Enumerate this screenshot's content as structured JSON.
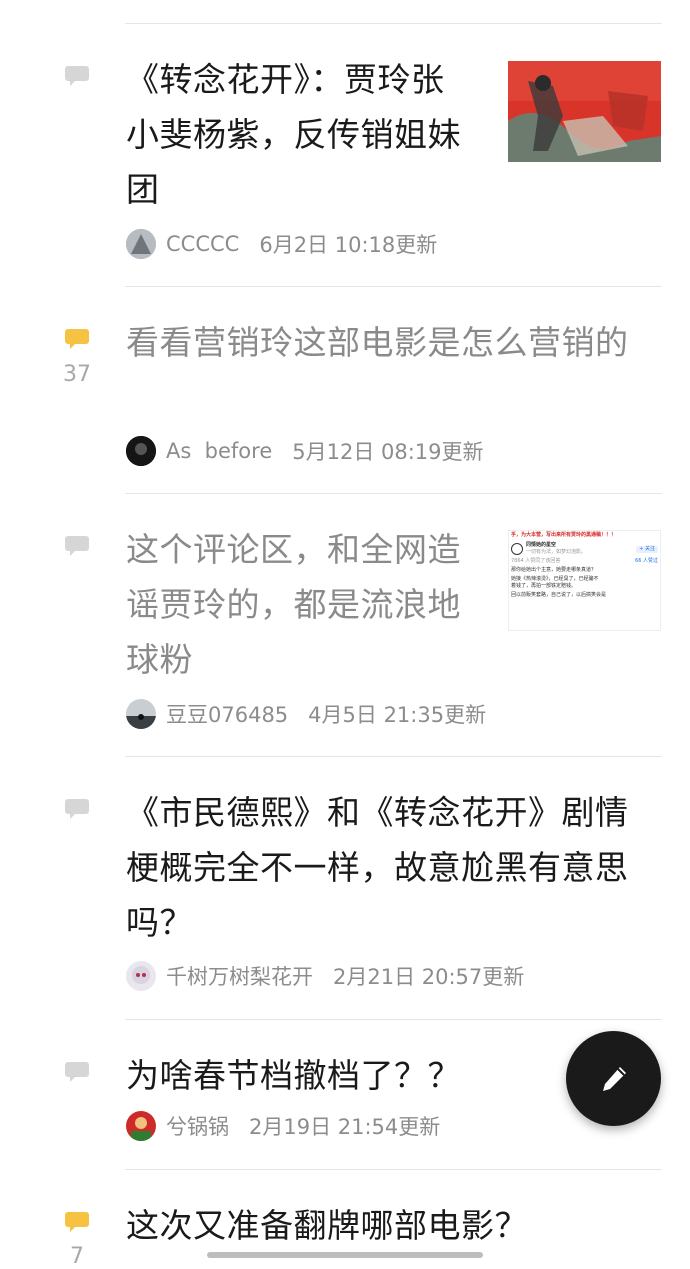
{
  "colors": {
    "bubble_unread": "#f5c242",
    "bubble_read": "#d6d6d6",
    "fab": "#1a1a1a"
  },
  "posts": [
    {
      "title": "《转念花开》：贾玲张小斐杨紫，反传销姐妹团",
      "author": "CCCCC",
      "time": "6月2日 10:18更新",
      "reply_count": "",
      "has_thumbnail": true,
      "read": false
    },
    {
      "title": "看看营销玲这部电影是怎么营销的",
      "author": "As  before",
      "time": "5月12日 08:19更新",
      "reply_count": "37",
      "has_thumbnail": false,
      "read": true
    },
    {
      "title": "这个评论区，和全网造谣贾玲的，都是流浪地球粉",
      "author": "豆豆076485",
      "time": "4月5日 21:35更新",
      "reply_count": "",
      "has_thumbnail": true,
      "read": true,
      "thumbnail": {
        "banner": "乎，为大本营，写出来所有贾玲的黑通稿！！！",
        "name": "同情她的星空",
        "follow": "+ 关注",
        "sub": "一切有为法，如梦幻泡影。",
        "stats": "7864 人赞同了该回答",
        "likes": "66 人赞过",
        "q": "那你给她出个主意，她要走哪条真道？",
        "line1": "她接《热辣滚烫》，已经臭了，已经骗不",
        "line2": "着钱了，再拍一部铁定赔钱。",
        "line3": "回以前贩笑套路，自己说了，以后搞笑会是"
      }
    },
    {
      "title": "《市民德熙》和《转念花开》剧情梗概完全不一样，故意尬黑有意思吗？",
      "author": "千树万树梨花开",
      "time": "2月21日 20:57更新",
      "reply_count": "",
      "has_thumbnail": false,
      "read": false
    },
    {
      "title": "为啥春节档撤档了？？",
      "author": "兮锅锅",
      "time": "2月19日 21:54更新",
      "reply_count": "",
      "has_thumbnail": false,
      "read": false
    },
    {
      "title": "这次又准备翻牌哪部电影？",
      "author": "",
      "time": "",
      "reply_count": "7",
      "has_thumbnail": false,
      "read": false
    }
  ],
  "fab_icon": "pen-icon",
  "icons": {
    "comment": "comment-bubble-icon"
  }
}
